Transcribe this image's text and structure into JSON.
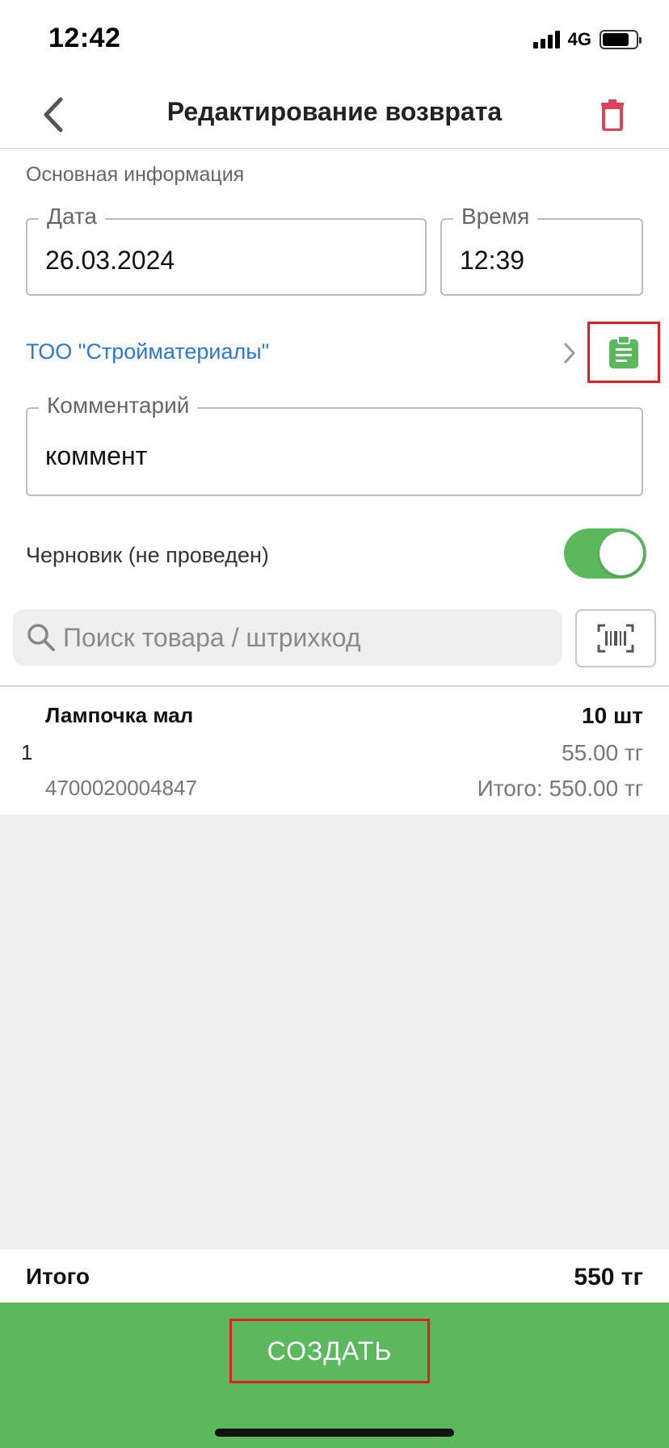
{
  "status_bar": {
    "time": "12:42",
    "network": "4G",
    "battery_level": 0.8
  },
  "header": {
    "title": "Редактирование возврата",
    "back_icon": "chevron-left-icon",
    "delete_icon": "trash-icon",
    "delete_color": "#e0405a"
  },
  "main_info": {
    "section_label": "Основная информация",
    "date": {
      "label": "Дата",
      "value": "26.03.2024"
    },
    "time": {
      "label": "Время",
      "value": "12:39"
    },
    "supplier": {
      "name": "ТОО \"Стройматериалы\"",
      "color": "#2a78d6"
    },
    "comment": {
      "label": "Комментарий",
      "value": "коммент"
    },
    "draft": {
      "label": "Черновик (не проведен)",
      "enabled": true
    }
  },
  "search": {
    "placeholder": "Поиск товара / штрихкод"
  },
  "items": [
    {
      "index": "1",
      "name": "Лампочка мал",
      "barcode": "4700020004847",
      "quantity": "10 шт",
      "price": "55.00 тг",
      "total": "Итого: 550.00 тг"
    }
  ],
  "summary": {
    "total_label": "Итого",
    "total_value": "550 тг"
  },
  "actions": {
    "create_label": "СОЗДАТЬ",
    "accent_color": "#5cb85c"
  }
}
